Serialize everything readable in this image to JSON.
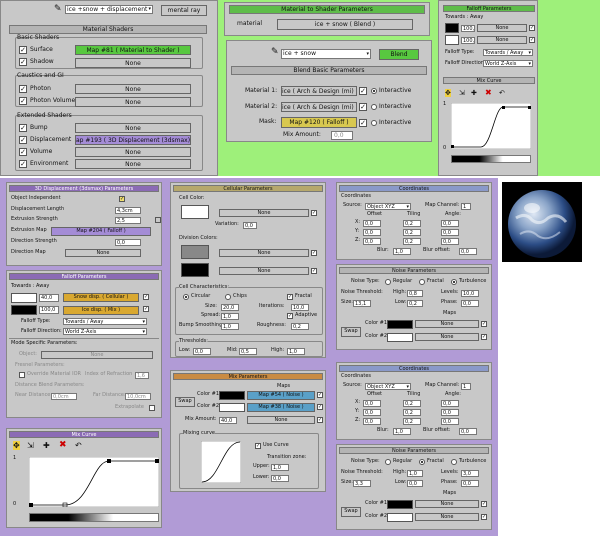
{
  "colors": {
    "green_bg": "#9ef07a",
    "purple_bg": "#b19bd6",
    "panel": "#c8c8c8",
    "map_green": "#58c840",
    "map_purple": "#a48cd6",
    "map_olive": "#d8c850",
    "map_orange": "#d9a830",
    "map_blue": "#5aa0c8"
  },
  "top_left": {
    "material_name": "ice +snow + displacement",
    "mat_type": "mental ray",
    "header": "Material Shaders",
    "basic_group": "Basic Shaders",
    "surface_label": "Surface",
    "surface_map": "Map #81  ( Material to Shader )",
    "shadow_label": "Shadow",
    "shadow_map": "None",
    "caustics_group": "Caustics and GI",
    "photon_label": "Photon",
    "photon_map": "None",
    "photon_volume_label": "Photon Volume",
    "photon_volume_map": "None",
    "extended_group": "Extended Shaders",
    "bump_label": "Bump",
    "bump_map": "None",
    "displacement_label": "Displacement",
    "displacement_map": "ap #193  ( 3D Displacement (3dsmax) )",
    "volume_label": "Volume",
    "volume_map": "None",
    "environment_label": "Environment",
    "environment_map": "None"
  },
  "mat_to_shader": {
    "header": "Material to Shader Parameters",
    "material_label": "material",
    "material_value": "ice + snow  ( Blend )"
  },
  "blend": {
    "name": "ice + snow",
    "type": "Blend",
    "header": "Blend Basic Parameters",
    "mat1_label": "Material 1:",
    "mat1_value": "ice  ( Arch & Design (mi) )",
    "mat2_label": "Material 2:",
    "mat2_value": "ice  ( Arch & Design (mi) )",
    "mask_label": "Mask:",
    "mask_value": "Map #120  ( Falloff )",
    "interactive": "Interactive",
    "mix_amount_label": "Mix Amount:",
    "mix_amount_value": "0,0"
  },
  "falloff_top": {
    "header": "Falloff Parameters",
    "towards": "Towards : Away",
    "v1": "100,0",
    "v2": "100,0",
    "none1": "None",
    "none2": "None",
    "type_label": "Falloff Type:",
    "type_value": "Towards / Away",
    "dir_label": "Falloff Direction:",
    "dir_value": "World Z-Axis",
    "curve_header": "Mix Curve",
    "axis_top": "1",
    "axis_bottom": "0"
  },
  "disp3d": {
    "header": "3D Displacement (3dsmax) Parameters",
    "obj_indep": "Object Independent",
    "disp_len_label": "Displacement Length",
    "disp_len_value": "4,3cm",
    "ext_str_label": "Extrusion Strength",
    "ext_str_value": "2,5",
    "ext_map_label": "Extrusion Map",
    "ext_map_value": "Map #204  ( Falloff )",
    "dir_str_label": "Direction Strength",
    "dir_str_value": "0,0",
    "dir_map_label": "Direction Map",
    "dir_map_value": "None"
  },
  "falloff_bl": {
    "header": "Falloff Parameters",
    "towards": "Towards : Away",
    "v1": "40,0",
    "v2": "100,0",
    "map1": "Snow disp.  ( Cellular )",
    "map2": "Ice disp.  ( Mix )",
    "type_label": "Falloff Type:",
    "type_value": "Towards / Away",
    "dir_label": "Falloff Direction:",
    "dir_value": "World Z-Axis",
    "mode_header": "Mode Specific Parameters:",
    "object_label": "Object:",
    "object_value": "None",
    "fresnel": "Fresnel Parameters:",
    "override": "Override Material IOR",
    "ior_label": "Index of Refraction",
    "ior_value": "1,6",
    "dist_blend": "Distance Blend Parameters:",
    "near_label": "Near Distance:",
    "near_value": "0,0cm",
    "far_label": "Far Distance:",
    "far_value": "10,0cm",
    "extrap": "Extrapolate"
  },
  "mix_curve_bl": {
    "header": "Mix Curve",
    "axis_top": "1",
    "axis_bottom": "0"
  },
  "cellular": {
    "header": "Cellular Parameters",
    "cell_color": "Cell Color:",
    "none": "None",
    "variation_label": "Variation:",
    "variation_value": "0,0",
    "div_colors": "Division Colors:",
    "characteristics": "Cell Characteristics:",
    "circular": "Circular",
    "chips": "Chips",
    "fractal": "Fractal",
    "size_label": "Size:",
    "size_value": "20,0",
    "iter_label": "Iterations:",
    "iter_value": "10,0",
    "spread_label": "Spread:",
    "spread_value": "1,0",
    "adaptive": "Adaptive",
    "bump_label": "Bump Smoothing:",
    "bump_value": "1,0",
    "rough_label": "Roughness:",
    "rough_value": "0,2",
    "thresholds": "Thresholds:",
    "low_label": "Low:",
    "low_value": "0,0",
    "mid_label": "Mid:",
    "mid_value": "0,5",
    "high_label": "High:",
    "high_value": "1,0"
  },
  "mixparams": {
    "header": "Mix Parameters",
    "maps": "Maps",
    "swap": "Swap",
    "color1": "Color #1",
    "color2": "Color #2",
    "map1": "Map #54  ( Noise )",
    "map2": "Map #38  ( Noise )",
    "mix_amount_label": "Mix Amount:",
    "mix_amount_value": "40,0",
    "none": "None",
    "mixing_curve": "Mixing curve",
    "use_curve": "Use Curve",
    "transition": "Transition zone:",
    "upper_label": "Upper:",
    "upper_value": "1,0",
    "lower_label": "Lower:",
    "lower_value": "0,0"
  },
  "coords1": {
    "header": "Coordinates",
    "source_label": "Source:",
    "source_value": "Object XYZ",
    "channel_label": "Map Channel:",
    "channel_value": "1",
    "offset": "Offset",
    "tiling": "Tiling",
    "angle": "Angle:",
    "x": "X:",
    "y": "Y:",
    "z": "Z:",
    "ox": "0,0",
    "oy": "0,0",
    "oz": "0,0",
    "tx": "0,2",
    "ty": "0,2",
    "tz": "0,2",
    "ax": "0,0",
    "ay": "0,0",
    "az": "0,0",
    "blur_label": "Blur:",
    "blur_value": "1,0",
    "bluroff_label": "Blur offset:",
    "bluroff_value": "0,0"
  },
  "noise1": {
    "header": "Noise Parameters",
    "type_label": "Noise Type:",
    "regular": "Regular",
    "fractal": "Fractal",
    "turbulence": "Turbulence",
    "thr_label": "Noise Threshold:",
    "high_label": "High:",
    "high_value": "0,8",
    "levels_label": "Levels:",
    "levels_value": "10,0",
    "size_label": "Size:",
    "size_value": "13,1",
    "low_label": "Low:",
    "low_value": "0,2",
    "phase_label": "Phase:",
    "phase_value": "0,0",
    "swap": "Swap",
    "maps": "Maps",
    "color1": "Color #1",
    "color2": "Color #2",
    "none": "None"
  },
  "coords2": {
    "header": "Coordinates",
    "source_label": "Source:",
    "source_value": "Object XYZ",
    "channel_label": "Map Channel:",
    "channel_value": "1",
    "offset": "Offset",
    "tiling": "Tiling",
    "angle": "Angle:",
    "x": "X:",
    "y": "Y:",
    "z": "Z:",
    "ox": "0,0",
    "oy": "0,0",
    "oz": "0,0",
    "tx": "0,2",
    "ty": "0,2",
    "tz": "0,2",
    "ax": "0,0",
    "ay": "0,0",
    "az": "0,0",
    "blur_label": "Blur:",
    "blur_value": "1,0",
    "bluroff_label": "Blur offset:",
    "bluroff_value": "0,0"
  },
  "noise2": {
    "header": "Noise Parameters",
    "type_label": "Noise Type:",
    "regular": "Regular",
    "fractal": "Fractal",
    "turbulence": "Turbulence",
    "thr_label": "Noise Threshold:",
    "high_label": "High:",
    "high_value": "1,0",
    "levels_label": "Levels:",
    "levels_value": "3,0",
    "size_label": "Size:",
    "size_value": "3,3",
    "low_label": "Low:",
    "low_value": "0,0",
    "phase_label": "Phase:",
    "phase_value": "0,0",
    "swap": "Swap",
    "maps": "Maps",
    "color1": "Color #1",
    "color2": "Color #2",
    "none": "None"
  }
}
